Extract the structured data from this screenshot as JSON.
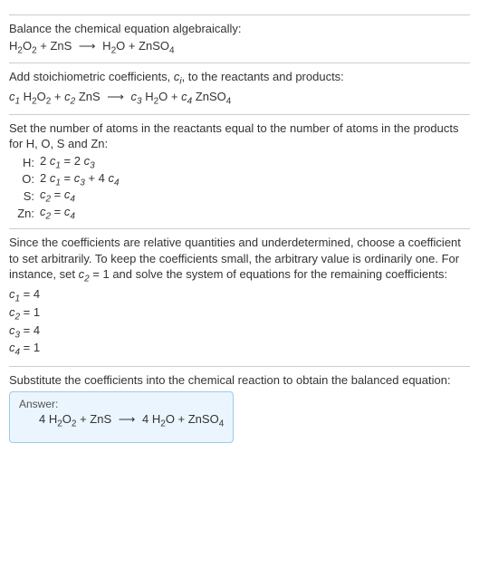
{
  "s1": {
    "line1": "Balance the chemical equation algebraically:",
    "eq_html": "H<span class=\"sub\">2</span>O<span class=\"sub\">2</span> + ZnS <span class=\"arrow\">⟶</span> H<span class=\"sub\">2</span>O + ZnSO<span class=\"sub\">4</span>"
  },
  "s2": {
    "line1_html": "Add stoichiometric coefficients, <span class=\"ci\">c<span class=\"sub\">i</span></span>, to the reactants and products:",
    "eq_html": "<span class=\"ci\">c<span class=\"sub\">1</span></span> H<span class=\"sub\">2</span>O<span class=\"sub\">2</span> + <span class=\"ci\">c<span class=\"sub\">2</span></span> ZnS <span class=\"arrow\">⟶</span> <span class=\"ci\">c<span class=\"sub\">3</span></span> H<span class=\"sub\">2</span>O + <span class=\"ci\">c<span class=\"sub\">4</span></span> ZnSO<span class=\"sub\">4</span>"
  },
  "s3": {
    "intro": "Set the number of atoms in the reactants equal to the number of atoms in the products for H, O, S and Zn:",
    "rows": [
      {
        "el": "H:",
        "eq_html": "2 <span class=\"ci\">c<span class=\"sub\">1</span></span> = 2 <span class=\"ci\">c<span class=\"sub\">3</span></span>"
      },
      {
        "el": "O:",
        "eq_html": "2 <span class=\"ci\">c<span class=\"sub\">1</span></span> = <span class=\"ci\">c<span class=\"sub\">3</span></span> + 4 <span class=\"ci\">c<span class=\"sub\">4</span></span>"
      },
      {
        "el": "S:",
        "eq_html": "<span class=\"ci\">c<span class=\"sub\">2</span></span> = <span class=\"ci\">c<span class=\"sub\">4</span></span>"
      },
      {
        "el": "Zn:",
        "eq_html": "<span class=\"ci\">c<span class=\"sub\">2</span></span> = <span class=\"ci\">c<span class=\"sub\">4</span></span>"
      }
    ]
  },
  "s4": {
    "intro_html": "Since the coefficients are relative quantities and underdetermined, choose a coefficient to set arbitrarily. To keep the coefficients small, the arbitrary value is ordinarily one. For instance, set <span class=\"ci\">c<span class=\"sub\">2</span></span> = 1 and solve the system of equations for the remaining coefficients:",
    "coeffs": [
      "<span class=\"ci\">c<span class=\"sub\">1</span></span> = 4",
      "<span class=\"ci\">c<span class=\"sub\">2</span></span> = 1",
      "<span class=\"ci\">c<span class=\"sub\">3</span></span> = 4",
      "<span class=\"ci\">c<span class=\"sub\">4</span></span> = 1"
    ]
  },
  "s5": {
    "intro": "Substitute the coefficients into the chemical reaction to obtain the balanced equation:",
    "answer_label": "Answer:",
    "answer_eq_html": "4 H<span class=\"sub\">2</span>O<span class=\"sub\">2</span> + ZnS <span class=\"arrow\">⟶</span> 4 H<span class=\"sub\">2</span>O + ZnSO<span class=\"sub\">4</span>"
  }
}
